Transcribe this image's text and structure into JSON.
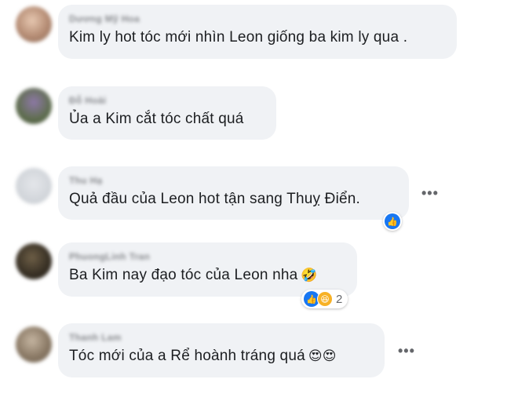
{
  "comments": [
    {
      "author": "Dương Mỹ Hoa",
      "text": "Kim ly hot tóc mới nhìn Leon giống ba kim ly qua .",
      "emoji": "",
      "avatar_color": "#c9a894",
      "reactions": null,
      "has_more": false
    },
    {
      "author": "Đỗ Hoài",
      "text": "Ủa a Kim cắt tóc chất quá",
      "emoji": "",
      "avatar_color": "#7b6a8e",
      "reactions": null,
      "has_more": false
    },
    {
      "author": "Thu Hạ",
      "text": "Quả đầu của Leon hot tận sang Thuỵ Điển.",
      "emoji": "",
      "avatar_color": "#d3d6db",
      "reactions": {
        "types": [
          "like"
        ],
        "count": ""
      },
      "has_more": true
    },
    {
      "author": "PhuongLinh Tran",
      "text": "Ba Kim nay đạo tóc của Leon nha",
      "emoji": "🤣",
      "avatar_color": "#3a3226",
      "reactions": {
        "types": [
          "like",
          "haha"
        ],
        "count": "2"
      },
      "has_more": false
    },
    {
      "author": "Thanh Lam",
      "text": "Tóc mới của a Rể hoành tráng quá",
      "emoji": "😍😍",
      "avatar_color": "#9c8a78",
      "reactions": null,
      "has_more": true
    }
  ],
  "icons": {
    "more": "more-options-icon",
    "like": "like-reaction-icon",
    "haha": "haha-reaction-icon"
  },
  "colors": {
    "bubble": "#f0f2f5",
    "like": "#1877f2",
    "haha": "#f7b125",
    "text": "#1c1e21",
    "muted": "#65676b"
  }
}
